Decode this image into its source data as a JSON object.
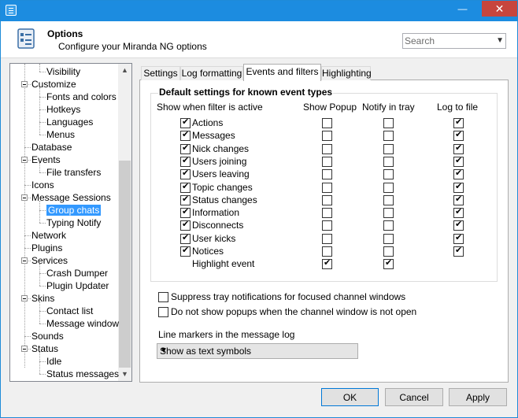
{
  "window": {
    "minimize_glyph": "—",
    "maximize_glyph": "☐",
    "close_glyph": "✕"
  },
  "header": {
    "title": "Options",
    "subtitle": "Configure your Miranda NG options",
    "search_placeholder": "Search"
  },
  "tree": [
    {
      "label": "Visibility",
      "level": 2
    },
    {
      "label": "Customize",
      "level": 1
    },
    {
      "label": "Fonts and colors",
      "level": 2
    },
    {
      "label": "Hotkeys",
      "level": 2
    },
    {
      "label": "Languages",
      "level": 2
    },
    {
      "label": "Menus",
      "level": 2
    },
    {
      "label": "Database",
      "level": 1
    },
    {
      "label": "Events",
      "level": 1
    },
    {
      "label": "File transfers",
      "level": 2
    },
    {
      "label": "Icons",
      "level": 1
    },
    {
      "label": "Message Sessions",
      "level": 1
    },
    {
      "label": "Group chats",
      "level": 2
    },
    {
      "label": "Typing Notify",
      "level": 2
    },
    {
      "label": "Network",
      "level": 1
    },
    {
      "label": "Plugins",
      "level": 1
    },
    {
      "label": "Services",
      "level": 1
    },
    {
      "label": "Crash Dumper",
      "level": 2
    },
    {
      "label": "Plugin Updater",
      "level": 2
    },
    {
      "label": "Skins",
      "level": 1
    },
    {
      "label": "Contact list",
      "level": 2
    },
    {
      "label": "Message window",
      "level": 2
    },
    {
      "label": "Sounds",
      "level": 1
    },
    {
      "label": "Status",
      "level": 1
    },
    {
      "label": "Idle",
      "level": 2
    },
    {
      "label": "Status messages",
      "level": 2
    }
  ],
  "tabs": [
    "Settings",
    "Log formatting",
    "Events and filters",
    "Highlighting"
  ],
  "active_tab": "Events and filters",
  "group": {
    "title": "Default settings for known event types",
    "col_filter": "Show when filter is active",
    "col_popup": "Show Popup",
    "col_tray": "Notify in tray",
    "col_log": "Log to file"
  },
  "events": [
    {
      "label": "Actions",
      "filter": true,
      "popup": false,
      "tray": false,
      "log": true
    },
    {
      "label": "Messages",
      "filter": true,
      "popup": false,
      "tray": false,
      "log": true
    },
    {
      "label": "Nick changes",
      "filter": true,
      "popup": false,
      "tray": false,
      "log": true
    },
    {
      "label": "Users joining",
      "filter": true,
      "popup": false,
      "tray": false,
      "log": true
    },
    {
      "label": "Users leaving",
      "filter": true,
      "popup": false,
      "tray": false,
      "log": true
    },
    {
      "label": "Topic changes",
      "filter": true,
      "popup": false,
      "tray": false,
      "log": true
    },
    {
      "label": "Status changes",
      "filter": true,
      "popup": false,
      "tray": false,
      "log": true
    },
    {
      "label": "Information",
      "filter": true,
      "popup": false,
      "tray": false,
      "log": true
    },
    {
      "label": "Disconnects",
      "filter": true,
      "popup": false,
      "tray": false,
      "log": true
    },
    {
      "label": "User kicks",
      "filter": true,
      "popup": false,
      "tray": false,
      "log": true
    },
    {
      "label": "Notices",
      "filter": true,
      "popup": false,
      "tray": false,
      "log": true
    }
  ],
  "highlight": {
    "label": "Highlight event",
    "popup": true,
    "tray": true
  },
  "options": [
    {
      "label": "Suppress tray notifications for focused channel windows",
      "checked": false
    },
    {
      "label": "Do not show popups when the channel window is not open",
      "checked": false
    }
  ],
  "line_markers": {
    "label": "Line markers in the message log",
    "selected": "Show as text symbols"
  },
  "buttons": {
    "ok": "OK",
    "cancel": "Cancel",
    "apply": "Apply"
  }
}
